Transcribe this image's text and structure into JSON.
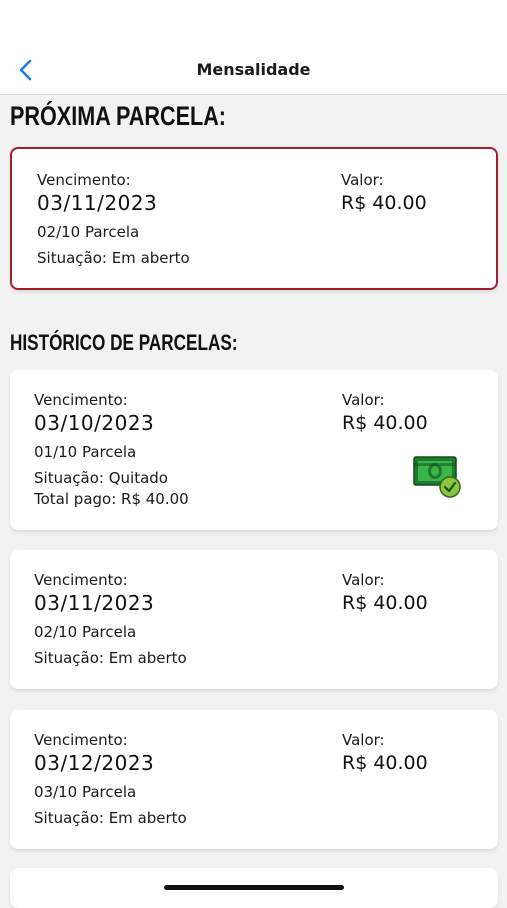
{
  "header": {
    "title": "Mensalidade",
    "back_icon": "chevron-left-icon",
    "accent": "#1a7cf5"
  },
  "next_section": {
    "title": "PRÓXIMA PARCELA:",
    "card": {
      "due_label": "Vencimento:",
      "due_date": "03/11/2023",
      "installment": "02/10 Parcela",
      "status": "Situação: Em aberto",
      "value_label": "Valor:",
      "value": "R$ 40.00",
      "border_color": "#a31f2e"
    }
  },
  "history_section": {
    "title": "HISTÓRICO DE PARCELAS:",
    "items": [
      {
        "due_label": "Vencimento:",
        "due_date": "03/10/2023",
        "installment": "01/10 Parcela",
        "status": "Situação: Quitado",
        "total_paid": "Total pago: R$ 40.00",
        "value_label": "Valor:",
        "value": "R$ 40.00",
        "icon": "paid-money-check-icon"
      },
      {
        "due_label": "Vencimento:",
        "due_date": "03/11/2023",
        "installment": "02/10 Parcela",
        "status": "Situação: Em aberto",
        "value_label": "Valor:",
        "value": "R$ 40.00"
      },
      {
        "due_label": "Vencimento:",
        "due_date": "03/12/2023",
        "installment": "03/10 Parcela",
        "status": "Situação: Em aberto",
        "value_label": "Valor:",
        "value": "R$ 40.00"
      }
    ]
  }
}
